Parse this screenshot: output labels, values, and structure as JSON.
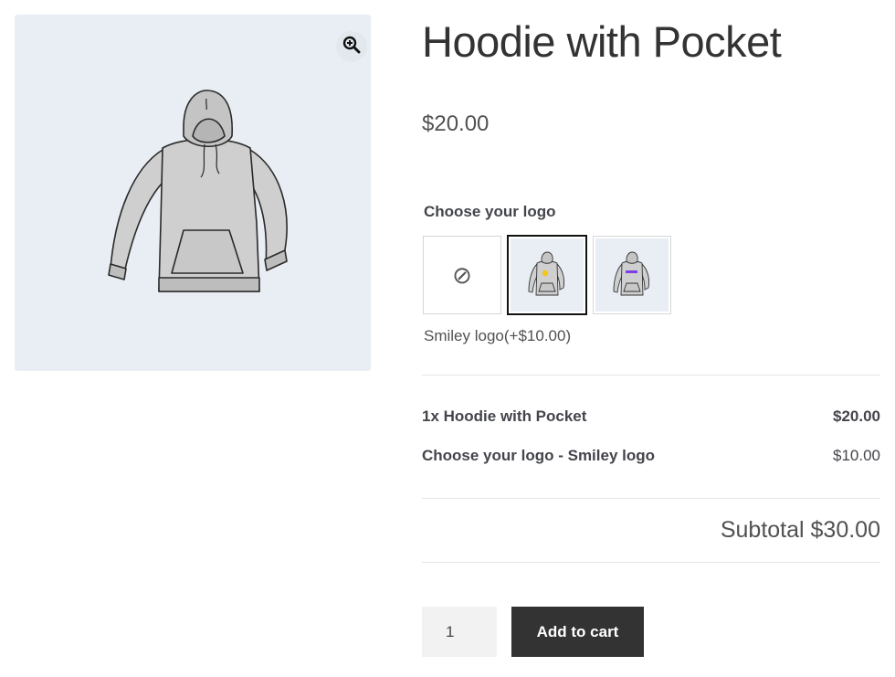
{
  "product": {
    "title": "Hoodie with Pocket",
    "price": "$20.00",
    "image_icon": "hoodie-image",
    "zoom_icon": "zoom-in-icon"
  },
  "addon": {
    "label": "Choose your logo",
    "options": [
      {
        "name": "No logo",
        "icon": "none-icon",
        "selected": false
      },
      {
        "name": "Smiley logo",
        "icon": "hoodie-smiley-image",
        "selected": true
      },
      {
        "name": "Purple logo",
        "icon": "hoodie-purple-logo-image",
        "selected": false
      }
    ],
    "selected_description": "Smiley logo(+$10.00)"
  },
  "totals": {
    "rows": [
      {
        "label": "1x Hoodie with Pocket",
        "amount": "$20.00"
      },
      {
        "label": "Choose your logo - Smiley logo",
        "amount": "$10.00"
      }
    ],
    "subtotal": "Subtotal $30.00"
  },
  "cart": {
    "quantity": "1",
    "add_label": "Add to cart"
  },
  "colors": {
    "gallery_bg": "#e8eef3",
    "button_bg": "#333333",
    "selected_border": "#111111",
    "logo_yellow": "#f5c518",
    "logo_purple": "#7b3fe4"
  }
}
